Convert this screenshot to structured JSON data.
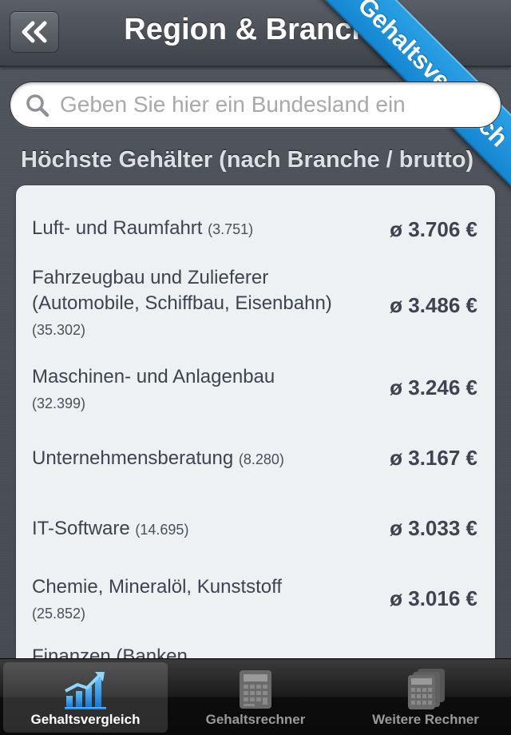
{
  "navbar": {
    "title": "Region & Branche",
    "back_icon": "double-chevron-left-icon"
  },
  "ribbon": {
    "label": "Gehaltsvergleich",
    "color": "#1f95dd"
  },
  "search": {
    "placeholder": "Geben Sie hier ein Bundesland ein",
    "value": ""
  },
  "section": {
    "header": "Höchste Gehälter (nach Branche / brutto)"
  },
  "rows": [
    {
      "label": "Luft- und Raumfahrt",
      "count": "(3.751)",
      "value": "ø 3.706 €"
    },
    {
      "label": "Fahrzeugbau und Zulieferer (Automobile, Schiffbau, Eisenbahn)",
      "count": "(35.302)",
      "value": "ø 3.486 €"
    },
    {
      "label": "Maschinen- und Anlagenbau",
      "count": "(32.399)",
      "value": "ø 3.246 €"
    },
    {
      "label": "Unternehmensberatung",
      "count": "(8.280)",
      "value": "ø 3.167 €"
    },
    {
      "label": "IT-Software",
      "count": "(14.695)",
      "value": "ø 3.033 €"
    },
    {
      "label": "Chemie, Mineralöl, Kunststoff",
      "count": "(25.852)",
      "value": "ø 3.016 €"
    },
    {
      "label": "Finanzen (Banken,",
      "count": "",
      "value": ""
    }
  ],
  "tabs": [
    {
      "label": "Gehaltsvergleich",
      "icon": "chart-icon",
      "active": true
    },
    {
      "label": "Gehaltsrechner",
      "icon": "calculator-icon",
      "active": false
    },
    {
      "label": "Weitere Rechner",
      "icon": "calculators-icon",
      "active": false
    }
  ]
}
